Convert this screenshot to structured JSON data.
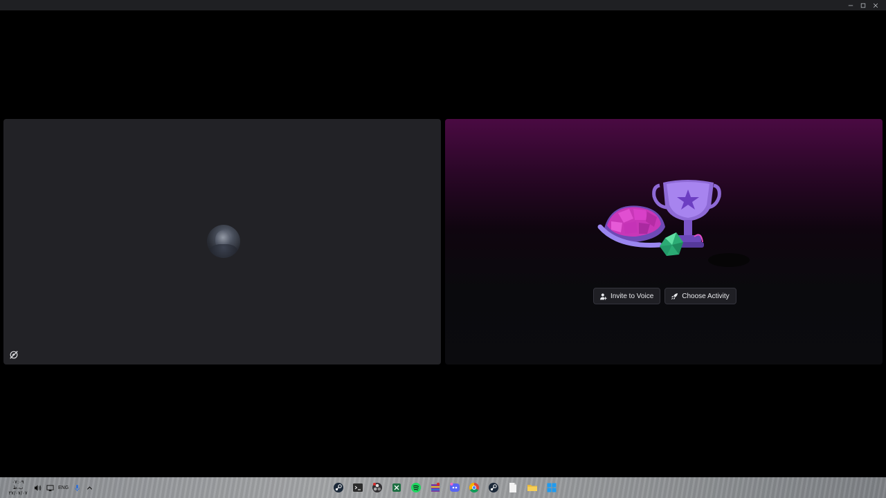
{
  "window": {
    "controls": [
      "minimize",
      "maximize",
      "close"
    ]
  },
  "left_tile": {
    "avatar_icon": "user-avatar",
    "status_icon": "screen-share-off-icon"
  },
  "right_tile": {
    "illustration": "activities-trophy-gems-illustration",
    "buttons": {
      "invite_label": "Invite to Voice",
      "activity_label": "Choose Activity"
    },
    "gradient_color": "#4a0a42"
  },
  "taskbar": {
    "clock_time": "۰۷:۰۹ ب.ظ",
    "clock_date": "۲۷/۰۷/۰۷",
    "language": "ENG",
    "apps": [
      "steam",
      "terminal",
      "obs",
      "excel",
      "spotify",
      "winrar",
      "discord",
      "chrome",
      "steam-2",
      "notepad",
      "file-explorer",
      "start"
    ]
  }
}
